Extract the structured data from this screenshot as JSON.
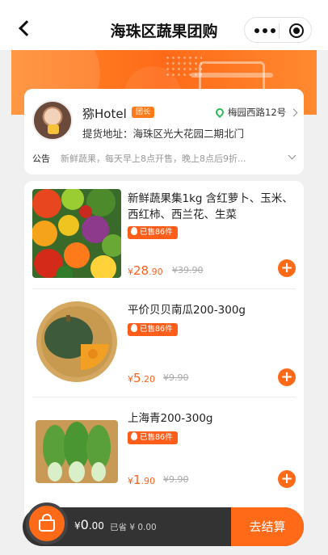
{
  "nav": {
    "title": "海珠区蔬果团购"
  },
  "leader": {
    "name": "猕Hotel",
    "badge": "团长",
    "location": "梅园西路12号",
    "pickup_address": "提货地址：海珠区光大花园二期北门",
    "notice_label": "公告",
    "notice_text": "新鲜蔬果，每天早上8点开售，晚上8点后9折..."
  },
  "products": [
    {
      "name": "新鲜蔬果集1kg  含红萝卜、玉米、西红柿、西兰花、生菜",
      "sold": "已售86件",
      "currency": "¥",
      "price_int": "28",
      "price_dec": ".90",
      "original_price": "¥39.90"
    },
    {
      "name": "平价贝贝南瓜200-300g",
      "sold": "已售86件",
      "currency": "¥",
      "price_int": "5",
      "price_dec": ".20",
      "original_price": "¥9.90"
    },
    {
      "name": "上海青200-300g",
      "sold": "已售86件",
      "currency": "¥",
      "price_int": "1",
      "price_dec": ".90",
      "original_price": "¥9.90"
    }
  ],
  "cart": {
    "currency": "¥",
    "total_int": "0",
    "total_dec": ".00",
    "saved": "已省 ¥ 0.00",
    "checkout_label": "去结算"
  },
  "colors": {
    "accent": "#ff6a18",
    "badge": "#ff7a1a",
    "location_pin": "#2bbb58",
    "cartbar": "#333333"
  },
  "icons": [
    "back-icon",
    "more-icon",
    "target-icon",
    "location-pin-icon",
    "chevron-right-icon",
    "chevron-down-icon",
    "flame-icon",
    "plus-icon",
    "basket-icon"
  ]
}
